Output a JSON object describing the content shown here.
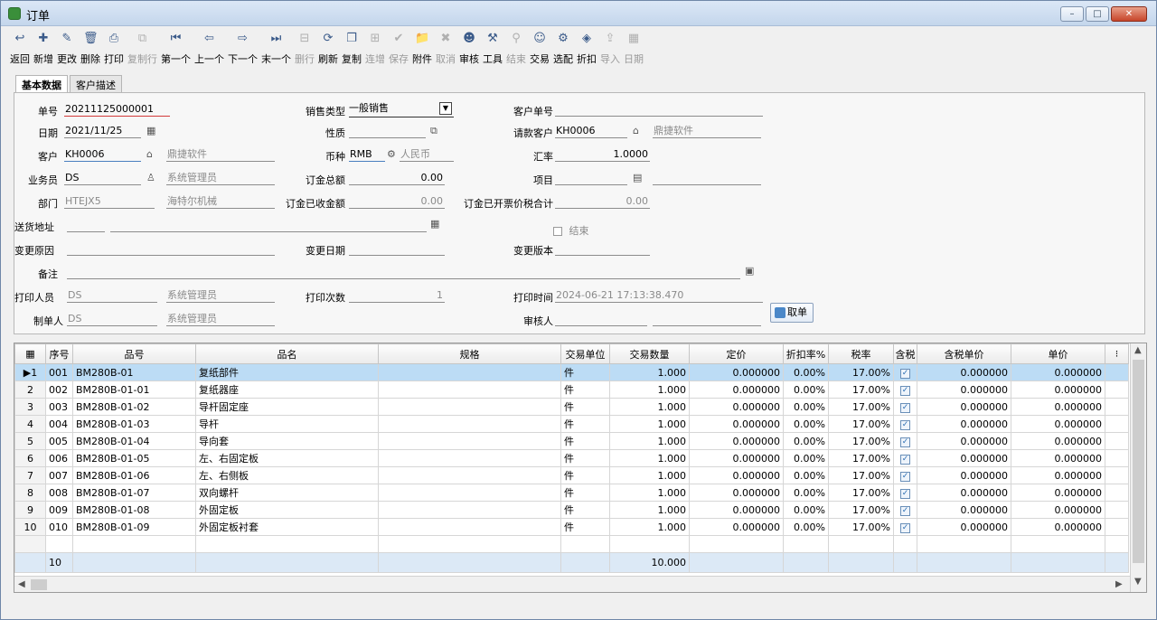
{
  "window": {
    "title": "订单",
    "buttons": {
      "min": "–",
      "max": "□",
      "close": "✕"
    }
  },
  "toolbar": [
    {
      "label": "返回",
      "icon": "↩",
      "enabled": true
    },
    {
      "label": "新增",
      "icon": "✚",
      "enabled": true
    },
    {
      "label": "更改",
      "icon": "✎",
      "enabled": true
    },
    {
      "label": "删除",
      "icon": "🗑",
      "enabled": true
    },
    {
      "label": "打印",
      "icon": "⎙",
      "enabled": true
    },
    {
      "label": "复制行",
      "icon": "⧉",
      "enabled": false
    },
    {
      "label": "第一个",
      "icon": "⏮",
      "enabled": true
    },
    {
      "label": "上一个",
      "icon": "⇦",
      "enabled": true
    },
    {
      "label": "下一个",
      "icon": "⇨",
      "enabled": true
    },
    {
      "label": "末一个",
      "icon": "⏭",
      "enabled": true
    },
    {
      "label": "删行",
      "icon": "⊟",
      "enabled": false
    },
    {
      "label": "刷新",
      "icon": "⟳",
      "enabled": true
    },
    {
      "label": "复制",
      "icon": "❐",
      "enabled": true
    },
    {
      "label": "连增",
      "icon": "⊞",
      "enabled": false
    },
    {
      "label": "保存",
      "icon": "✔",
      "enabled": false
    },
    {
      "label": "附件",
      "icon": "📁",
      "enabled": true
    },
    {
      "label": "取消",
      "icon": "✖",
      "enabled": false
    },
    {
      "label": "审核",
      "icon": "☻",
      "enabled": true
    },
    {
      "label": "工具",
      "icon": "⚒",
      "enabled": true
    },
    {
      "label": "结束",
      "icon": "⚲",
      "enabled": false
    },
    {
      "label": "交易",
      "icon": "☺",
      "enabled": true
    },
    {
      "label": "选配",
      "icon": "⚙",
      "enabled": true
    },
    {
      "label": "折扣",
      "icon": "◈",
      "enabled": true
    },
    {
      "label": "导入",
      "icon": "⇪",
      "enabled": false
    },
    {
      "label": "日期",
      "icon": "▦",
      "enabled": false
    }
  ],
  "tabs": [
    {
      "label": "基本数据"
    },
    {
      "label": "客户描述"
    }
  ],
  "form": {
    "order_no_label": "单号",
    "order_no": "20211125000001",
    "sales_type_label": "销售类型",
    "sales_type": "一般销售",
    "customer_order_label": "客户单号",
    "customer_order": "",
    "date_label": "日期",
    "date": "2021/11/25",
    "nature_label": "性质",
    "nature": "",
    "pay_customer_label": "请款客户",
    "pay_customer": "KH0006",
    "pay_customer_name": "鼎捷软件",
    "customer_label": "客户",
    "customer": "KH0006",
    "customer_name": "鼎捷软件",
    "currency_label": "币种",
    "currency": "RMB",
    "currency_name": "人民币",
    "rate_label": "汇率",
    "rate": "1.0000",
    "salesman_label": "业务员",
    "salesman": "DS",
    "salesman_name": "系统管理员",
    "deposit_total_label": "订金总额",
    "deposit_total": "0.00",
    "project_label": "项目",
    "project": "",
    "dept_label": "部门",
    "dept": "HTEJX5",
    "dept_name": "海特尔机械",
    "deposit_received_label": "订金已收金额",
    "deposit_received": "0.00",
    "deposit_invoiced_label": "订金已开票价税合计",
    "deposit_invoiced": "0.00",
    "ship_addr_label": "送货地址",
    "ship_addr": "",
    "closed_label": "结束",
    "change_reason_label": "变更原因",
    "change_reason": "",
    "change_date_label": "变更日期",
    "change_date": "",
    "change_ver_label": "变更版本",
    "change_ver": "",
    "remark_label": "备注",
    "remark": "",
    "printer_label": "打印人员",
    "printer": "DS",
    "printer_name": "系统管理员",
    "print_count_label": "打印次数",
    "print_count": "1",
    "print_time_label": "打印时间",
    "print_time": "2024-06-21 17:13:38.470",
    "maker_label": "制单人",
    "maker": "DS",
    "maker_name": "系统管理员",
    "auditor_label": "审核人",
    "auditor": "",
    "quote_button": "取单"
  },
  "grid": {
    "headers": [
      "序号",
      "品号",
      "品名",
      "规格",
      "交易单位",
      "交易数量",
      "定价",
      "折扣率%",
      "税率",
      "含税",
      "含税单价",
      "单价"
    ],
    "rows": [
      [
        "001",
        "BM280B-01",
        "复纸部件",
        "",
        "件",
        "1.000",
        "0.000000",
        "0.00%",
        "17.00%",
        "0.000000",
        "0.000000"
      ],
      [
        "002",
        "BM280B-01-01",
        "复纸器座",
        "",
        "件",
        "1.000",
        "0.000000",
        "0.00%",
        "17.00%",
        "0.000000",
        "0.000000"
      ],
      [
        "003",
        "BM280B-01-02",
        "导杆固定座",
        "",
        "件",
        "1.000",
        "0.000000",
        "0.00%",
        "17.00%",
        "0.000000",
        "0.000000"
      ],
      [
        "004",
        "BM280B-01-03",
        "导杆",
        "",
        "件",
        "1.000",
        "0.000000",
        "0.00%",
        "17.00%",
        "0.000000",
        "0.000000"
      ],
      [
        "005",
        "BM280B-01-04",
        "导向套",
        "",
        "件",
        "1.000",
        "0.000000",
        "0.00%",
        "17.00%",
        "0.000000",
        "0.000000"
      ],
      [
        "006",
        "BM280B-01-05",
        "左、右固定板",
        "",
        "件",
        "1.000",
        "0.000000",
        "0.00%",
        "17.00%",
        "0.000000",
        "0.000000"
      ],
      [
        "007",
        "BM280B-01-06",
        "左、右侧板",
        "",
        "件",
        "1.000",
        "0.000000",
        "0.00%",
        "17.00%",
        "0.000000",
        "0.000000"
      ],
      [
        "008",
        "BM280B-01-07",
        "双向螺杆",
        "",
        "件",
        "1.000",
        "0.000000",
        "0.00%",
        "17.00%",
        "0.000000",
        "0.000000"
      ],
      [
        "009",
        "BM280B-01-08",
        "外固定板",
        "",
        "件",
        "1.000",
        "0.000000",
        "0.00%",
        "17.00%",
        "0.000000",
        "0.000000"
      ],
      [
        "010",
        "BM280B-01-09",
        "外固定板衬套",
        "",
        "件",
        "1.000",
        "0.000000",
        "0.00%",
        "17.00%",
        "0.000000",
        "0.000000"
      ]
    ],
    "total_count": "10",
    "total_qty": "10.000"
  }
}
